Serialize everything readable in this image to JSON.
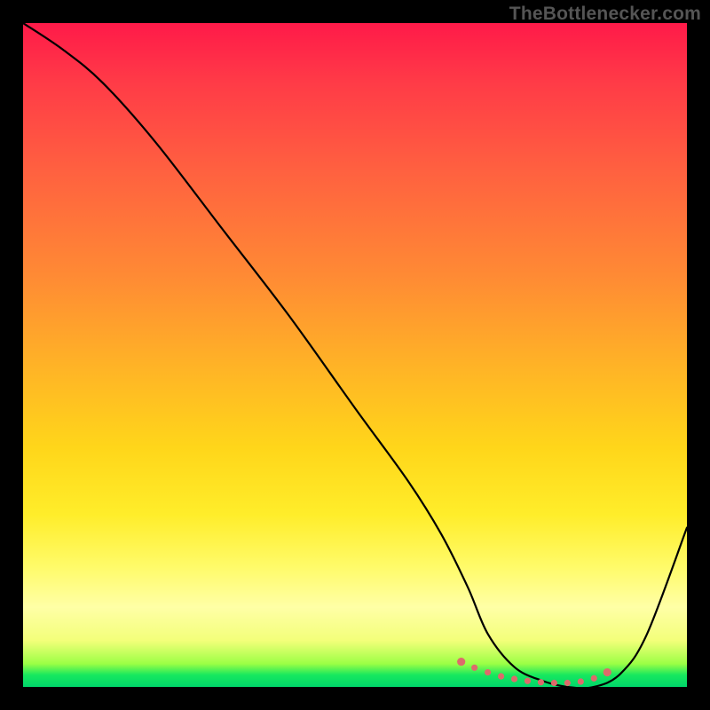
{
  "attribution": "TheBottlenecker.com",
  "chart_data": {
    "type": "line",
    "title": "",
    "xlabel": "",
    "ylabel": "",
    "xlim": [
      0,
      100
    ],
    "ylim": [
      0,
      100
    ],
    "series": [
      {
        "name": "bottleneck-curve",
        "x": [
          0,
          6,
          12,
          20,
          30,
          40,
          50,
          58,
          63,
          67,
          70,
          74,
          78,
          82,
          86,
          90,
          94,
          100
        ],
        "y": [
          100,
          96,
          91,
          82,
          69,
          56,
          42,
          31,
          23,
          15,
          8,
          3,
          1,
          0,
          0,
          2,
          8,
          24
        ]
      }
    ],
    "markers": {
      "name": "optimal-range-dots",
      "color": "#e57373",
      "x": [
        66,
        68,
        70,
        72,
        74,
        76,
        78,
        80,
        82,
        84,
        86,
        88
      ],
      "y": [
        3.8,
        2.9,
        2.2,
        1.6,
        1.2,
        0.9,
        0.7,
        0.6,
        0.6,
        0.8,
        1.3,
        2.2
      ]
    },
    "colors": {
      "curve": "#000000",
      "marker": "#dd6b6b"
    }
  }
}
